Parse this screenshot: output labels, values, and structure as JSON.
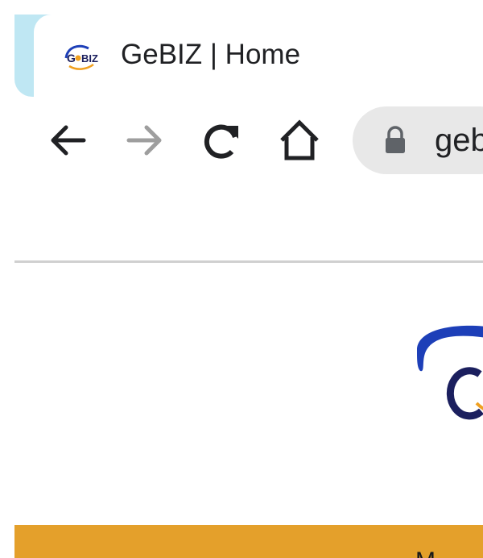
{
  "browser": {
    "tab": {
      "title": "GeBIZ | Home",
      "favicon": "gebiz-favicon-icon"
    },
    "toolbar": {
      "back": "arrow-left-icon",
      "forward": "arrow-right-icon",
      "reload": "reload-icon",
      "home": "home-icon"
    },
    "omnibox": {
      "lock": "lock-icon",
      "url_visible": "geb"
    }
  },
  "colors": {
    "tab_accent": "#bfe7f3",
    "omnibox_bg": "#e8e8e8",
    "nav_bar": "#e4a02b",
    "logo_blue": "#1d3fb8",
    "logo_navy": "#1b1f5e",
    "logo_orange": "#f0a020",
    "forward_disabled": "#9e9e9e"
  },
  "page": {
    "logo": "gebiz-logo",
    "nav_bar_text": "M"
  }
}
